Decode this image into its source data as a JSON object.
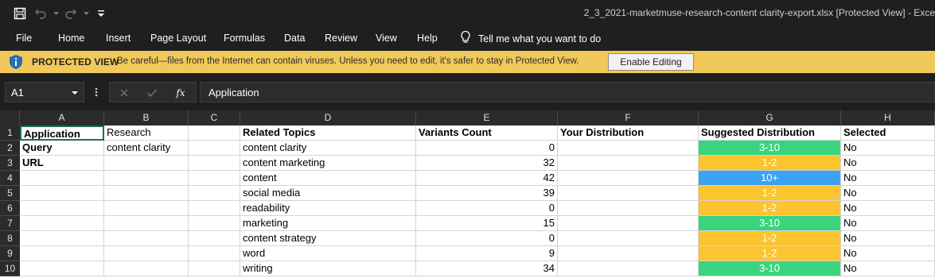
{
  "window": {
    "title": "2_3_2021-marketmuse-research-content clarity-export.xlsx  [Protected View]  -  Exce"
  },
  "quick_access": {
    "icons": [
      "save-icon",
      "undo-icon",
      "redo-icon",
      "customize-icon"
    ]
  },
  "ribbon": {
    "tabs": [
      "File",
      "Home",
      "Insert",
      "Page Layout",
      "Formulas",
      "Data",
      "Review",
      "View",
      "Help"
    ],
    "tell_me": "Tell me what you want to do"
  },
  "protected_view": {
    "title": "PROTECTED VIEW",
    "message": "Be careful—files from the Internet can contain viruses. Unless you need to edit, it's safer to stay in Protected View.",
    "button": "Enable Editing"
  },
  "formula_bar": {
    "name_box": "A1",
    "fx_label": "fx",
    "content": "Application"
  },
  "colors": {
    "green": "#3ad47f",
    "yellow": "#fcc42e",
    "blue": "#3ba3f1",
    "pv_bar": "#f1c95a"
  },
  "sheet": {
    "columns": [
      "A",
      "B",
      "C",
      "D",
      "E",
      "F",
      "G",
      "H"
    ],
    "rows": [
      "1",
      "2",
      "3",
      "4",
      "5",
      "6",
      "7",
      "8",
      "9",
      "10"
    ],
    "header": [
      "Application",
      "Research",
      "",
      "Related Topics",
      "Variants Count",
      "Your Distribution",
      "Suggested Distribution",
      "Selected"
    ],
    "data": [
      {
        "a": "Query",
        "b": "content clarity",
        "d": "content clarity",
        "e": "0",
        "g": "3-10",
        "g_color": "green",
        "h": "No"
      },
      {
        "a": "URL",
        "b": "",
        "d": "content marketing",
        "e": "32",
        "g": "1-2",
        "g_color": "yellow",
        "h": "No"
      },
      {
        "a": "",
        "b": "",
        "d": "content",
        "e": "42",
        "g": "10+",
        "g_color": "blue",
        "h": "No"
      },
      {
        "a": "",
        "b": "",
        "d": "social media",
        "e": "39",
        "g": "1-2",
        "g_color": "yellow",
        "h": "No"
      },
      {
        "a": "",
        "b": "",
        "d": "readability",
        "e": "0",
        "g": "1-2",
        "g_color": "yellow",
        "h": "No"
      },
      {
        "a": "",
        "b": "",
        "d": "marketing",
        "e": "15",
        "g": "3-10",
        "g_color": "green",
        "h": "No"
      },
      {
        "a": "",
        "b": "",
        "d": "content strategy",
        "e": "0",
        "g": "1-2",
        "g_color": "yellow",
        "h": "No"
      },
      {
        "a": "",
        "b": "",
        "d": "word",
        "e": "9",
        "g": "1-2",
        "g_color": "yellow",
        "h": "No"
      },
      {
        "a": "",
        "b": "",
        "d": "writing",
        "e": "34",
        "g": "3-10",
        "g_color": "green",
        "h": "No"
      }
    ]
  }
}
